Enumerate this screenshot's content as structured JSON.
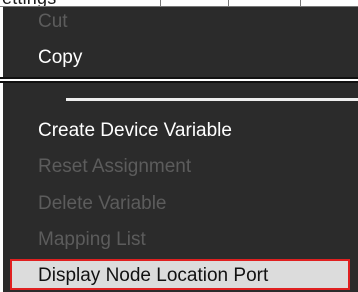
{
  "background": {
    "text_fragment": "ettings"
  },
  "context_menu": {
    "items": [
      {
        "label": "Cut",
        "enabled": false
      },
      {
        "label": "Copy",
        "enabled": true
      },
      {
        "label": "Create Device Variable",
        "enabled": true
      },
      {
        "label": "Reset Assignment",
        "enabled": false
      },
      {
        "label": "Delete Variable",
        "enabled": false
      },
      {
        "label": "Mapping List",
        "enabled": false
      },
      {
        "label": "Display Node Location Port",
        "enabled": true,
        "highlighted": true
      }
    ]
  },
  "colors": {
    "menu_background": "#2b2b2b",
    "enabled_text": "#ffffff",
    "disabled_text": "#5c5c5c",
    "highlight_background": "#dcdcdc",
    "highlight_border": "#e02020"
  }
}
